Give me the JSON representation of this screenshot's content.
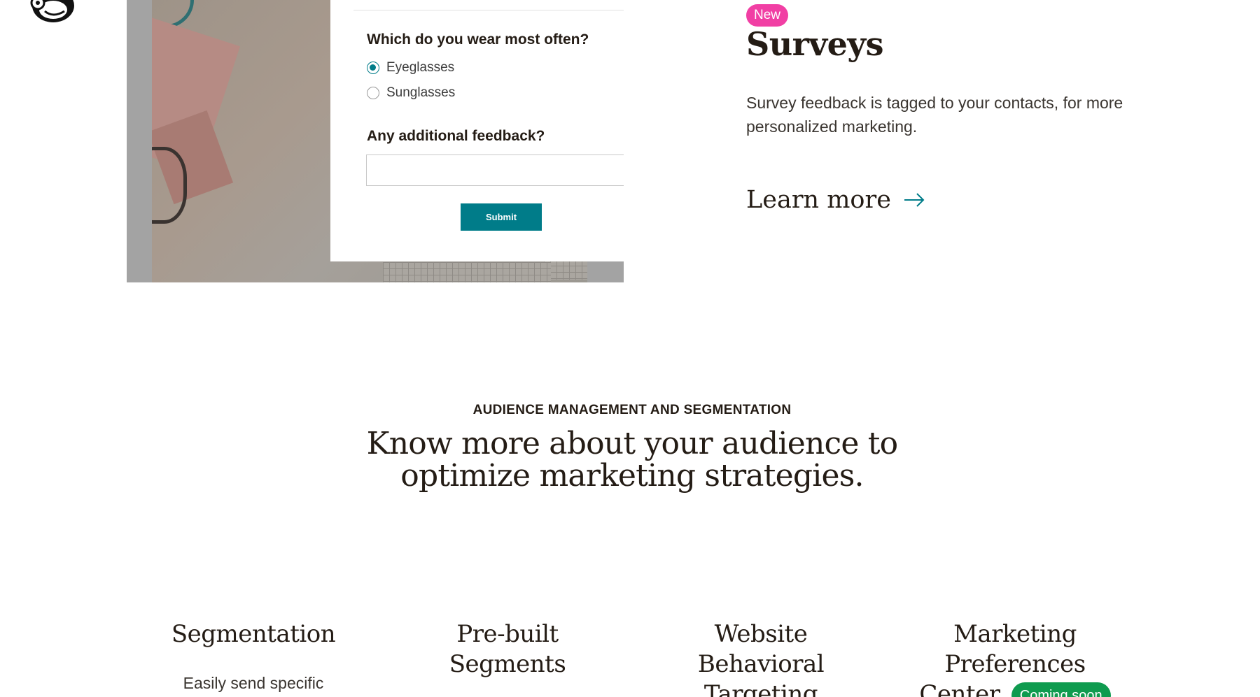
{
  "survey_form": {
    "question1": "Which do you wear most often?",
    "options": [
      "Eyeglasses",
      "Sunglasses"
    ],
    "selected_option": "Eyeglasses",
    "question2": "Any additional feedback?",
    "feedback_value": "",
    "submit_label": "Submit"
  },
  "surveys_feature": {
    "badge": "New",
    "title": "Surveys",
    "description": "Survey feedback is tagged to your contacts, for more personalized marketing.",
    "link_label": "Learn more"
  },
  "audience_section": {
    "eyebrow": "AUDIENCE MANAGEMENT AND SEGMENTATION",
    "headline_line1": "Know more about your audience to",
    "headline_line2": "optimize marketing strategies.",
    "features": [
      {
        "title": "Segmentation",
        "description": "Easily send specific"
      },
      {
        "title": "Pre-built Segments"
      },
      {
        "title": "Website Behavioral Targeting"
      },
      {
        "title": "Marketing Preferences Center",
        "badge": "Coming soon"
      }
    ]
  },
  "colors": {
    "accent_teal": "#007c89",
    "badge_pink": "#f13fa4",
    "badge_green": "#0f9b4f",
    "text_dark": "#241c15"
  },
  "icons": [
    "mailchimp-logo-icon",
    "arrow-right-icon",
    "radio-checked-icon",
    "radio-unchecked-icon"
  ]
}
